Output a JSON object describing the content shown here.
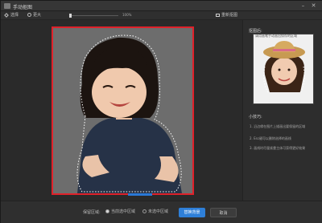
{
  "window": {
    "title": "手动抠图"
  },
  "toolbar": {
    "select_label": "选择",
    "bigger_label": "更大",
    "zoom_value": "100%",
    "zoom_level": 0,
    "reset_label": "重新抠图"
  },
  "panel": {
    "preview_title": "抠图后:",
    "preview_desc": "请用画笔手动画出保存的区域",
    "tips_title": "小技巧:",
    "tips": [
      "1. 沿边缘在图片上描画出要保留的区域",
      "2. Esc键可以删除选择的画线",
      "3. 画线时尽量紧靠主体可获得更好效果"
    ]
  },
  "bottom": {
    "option_label": "保留区域:",
    "radio_keep": "当前选中区域",
    "radio_remove": "未选中区域",
    "apply_label": "替换背景",
    "cancel_label": "取消"
  },
  "colors": {
    "accent": "#2e7fd8",
    "frame": "#e0212a",
    "background": "#2d2d2d"
  }
}
